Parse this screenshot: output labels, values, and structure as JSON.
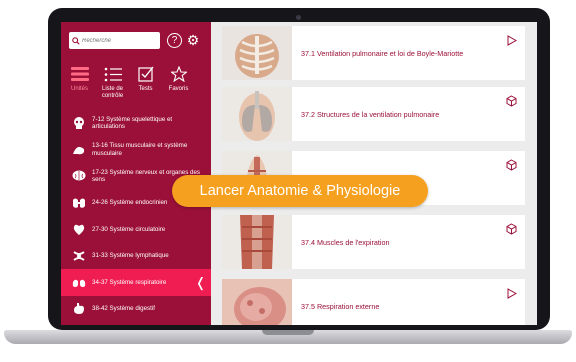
{
  "search": {
    "placeholder": "Recherche"
  },
  "tabs": [
    {
      "label": "Unités",
      "icon": "list-bars-icon"
    },
    {
      "label": "Liste de contrôle",
      "icon": "bulleted-list-icon"
    },
    {
      "label": "Tests",
      "icon": "checkbox-icon"
    },
    {
      "label": "Favoris",
      "icon": "star-icon"
    }
  ],
  "menu": [
    {
      "label": "7-12 Système squelettique et articulations",
      "icon": "skull-icon"
    },
    {
      "label": "13-16 Tissu musculaire et système musculaire",
      "icon": "arm-muscle-icon"
    },
    {
      "label": "17-23 Système nerveux et organes des sens",
      "icon": "brain-icon"
    },
    {
      "label": "24-26 Système endocrinien",
      "icon": "thyroid-icon"
    },
    {
      "label": "27-30 Système circulatoire",
      "icon": "heart-icon"
    },
    {
      "label": "31-33 Système lymphatique",
      "icon": "lymph-icon"
    },
    {
      "label": "34-37 Système respiratoire",
      "icon": "lungs-icon"
    },
    {
      "label": "38-42 Système digestif",
      "icon": "stomach-icon"
    }
  ],
  "cards": [
    {
      "title": "37.1 Ventilation pulmonaire et loi de Boyle-Mariotte",
      "action": "play-icon"
    },
    {
      "title": "37.2 Structures de la ventilation pulmonaire",
      "action": "cube-icon"
    },
    {
      "title": "",
      "action": "cube-icon"
    },
    {
      "title": "37.4 Muscles de l'expiration",
      "action": "cube-icon"
    },
    {
      "title": "37.5 Respiration externe",
      "action": "play-icon"
    }
  ],
  "banner": {
    "label": "Lancer Anatomie & Physiologie"
  },
  "colors": {
    "sidebar": "#9b1038",
    "active_item": "#ef1d52",
    "accent_text": "#9b1038",
    "banner": "#f6a020"
  }
}
